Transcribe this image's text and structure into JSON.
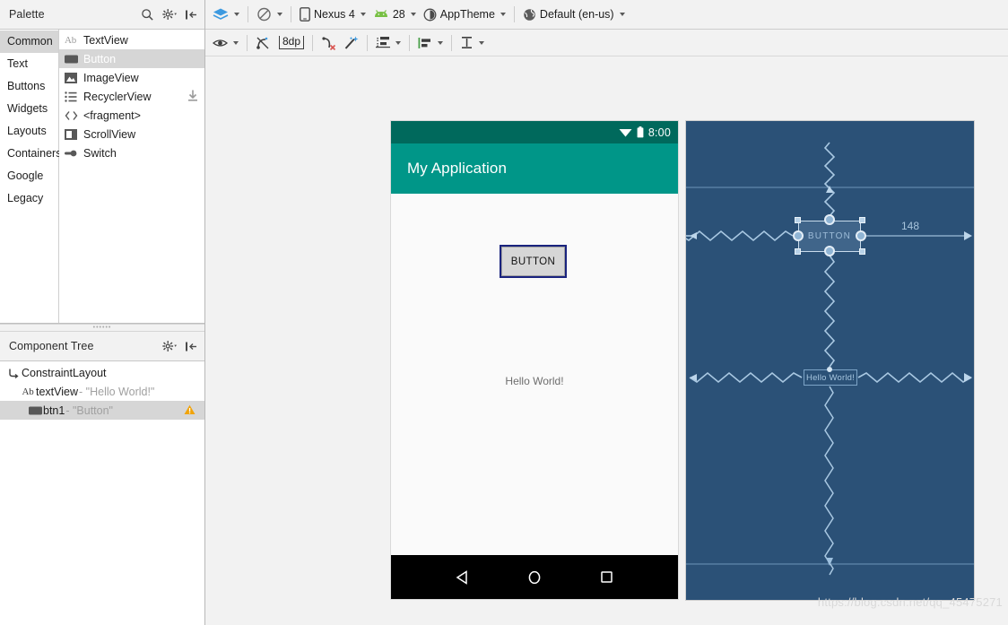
{
  "palette": {
    "title": "Palette",
    "icons": {
      "search": "search-icon",
      "gear": "gear-icon",
      "collapse": "collapse-panel-icon"
    },
    "categories": [
      {
        "label": "Common",
        "selected": true
      },
      {
        "label": "Text",
        "selected": false
      },
      {
        "label": "Buttons",
        "selected": false
      },
      {
        "label": "Widgets",
        "selected": false
      },
      {
        "label": "Layouts",
        "selected": false
      },
      {
        "label": "Containers",
        "selected": false
      },
      {
        "label": "Google",
        "selected": false
      },
      {
        "label": "Legacy",
        "selected": false
      }
    ],
    "widgets": [
      {
        "label": "TextView",
        "icon": "ab-text-icon",
        "selected": false,
        "download": false
      },
      {
        "label": "Button",
        "icon": "button-icon",
        "selected": true,
        "download": false
      },
      {
        "label": "ImageView",
        "icon": "image-icon",
        "selected": false,
        "download": false
      },
      {
        "label": "RecyclerView",
        "icon": "list-icon",
        "selected": false,
        "download": true
      },
      {
        "label": "<fragment>",
        "icon": "code-brackets-icon",
        "selected": false,
        "download": false
      },
      {
        "label": "ScrollView",
        "icon": "scroll-icon",
        "selected": false,
        "download": false
      },
      {
        "label": "Switch",
        "icon": "switch-icon",
        "selected": false,
        "download": false
      }
    ]
  },
  "component_tree": {
    "title": "Component Tree",
    "icons": {
      "gear": "gear-icon",
      "collapse": "collapse-panel-icon"
    },
    "rows": [
      {
        "icon": "constraint-layout-icon",
        "name": "ConstraintLayout",
        "value": "",
        "indent": 0,
        "selected": false,
        "warning": false
      },
      {
        "icon": "ab-text-icon",
        "name": "textView",
        "value": "- \"Hello World!\"",
        "indent": 1,
        "selected": false,
        "warning": false
      },
      {
        "icon": "button-icon",
        "name": "btn1",
        "value": "- \"Button\"",
        "indent": 2,
        "selected": true,
        "warning": true
      }
    ]
  },
  "toolbar": {
    "row1": [
      {
        "type": "icon-dropdown",
        "icon": "design-surface-icon",
        "label": ""
      },
      {
        "type": "icon-dropdown",
        "icon": "orientation-icon",
        "label": ""
      },
      {
        "type": "icon-dropdown",
        "icon": "device-icon",
        "label": "Nexus 4"
      },
      {
        "type": "icon-dropdown",
        "icon": "android-api-icon",
        "label": "28"
      },
      {
        "type": "icon-dropdown",
        "icon": "theme-icon",
        "label": "AppTheme"
      },
      {
        "type": "icon-dropdown",
        "icon": "locale-globe-icon",
        "label": "Default (en-us)"
      }
    ],
    "row2": [
      {
        "type": "icon-dropdown",
        "icon": "eye-visibility-icon",
        "label": ""
      },
      {
        "type": "icon",
        "icon": "clear-constraints-icon",
        "label": ""
      },
      {
        "type": "value",
        "icon": "default-margin-icon",
        "label": "8dp"
      },
      {
        "type": "icon",
        "icon": "clear-all-constraints-icon",
        "label": ""
      },
      {
        "type": "icon",
        "icon": "infer-constraints-magic-icon",
        "label": ""
      },
      {
        "type": "icon-dropdown",
        "icon": "guidelines-icon",
        "label": ""
      },
      {
        "type": "icon-dropdown",
        "icon": "align-icon",
        "label": ""
      },
      {
        "type": "icon-dropdown",
        "icon": "vertical-distribute-icon",
        "label": ""
      }
    ]
  },
  "device_preview": {
    "status_time": "8:00",
    "wifi_icon": "wifi-icon",
    "battery_icon": "battery-icon",
    "app_title": "My Application",
    "button_label": "BUTTON",
    "hello_text": "Hello World!",
    "nav": {
      "back": "back-triangle-icon",
      "home": "home-circle-icon",
      "recents": "recents-square-icon"
    },
    "colors": {
      "status_bar": "#00695c",
      "app_bar": "#009688",
      "screen": "#fafafa",
      "nav_bar": "#000000",
      "selection": "#1a237e"
    }
  },
  "blueprint": {
    "button_label": "BUTTON",
    "hello_label": "Hello World!",
    "margin_value": "148",
    "colors": {
      "background": "#2b5177",
      "stroke": "#7fa6c9",
      "selected": "#c9dcec"
    }
  },
  "watermark": {
    "text": "https://blog.csdn.net/qq_45475271"
  }
}
